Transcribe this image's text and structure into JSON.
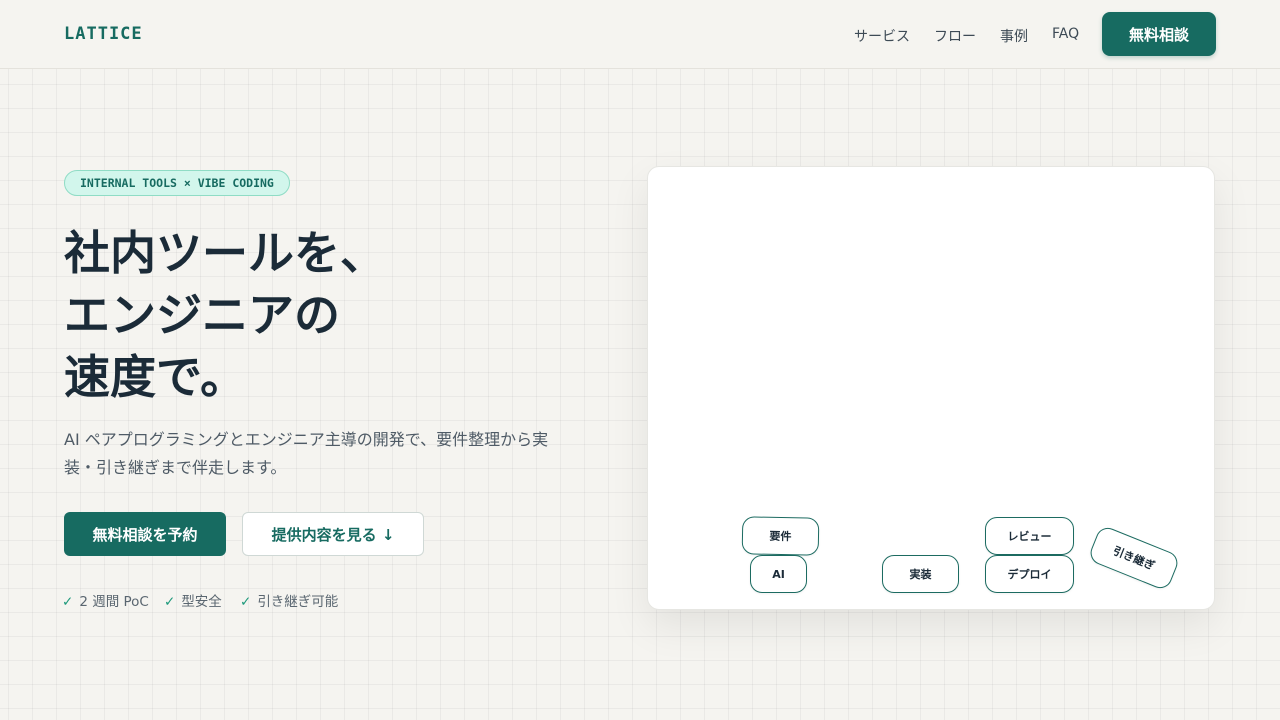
{
  "header": {
    "logo": "LATTICE",
    "nav": [
      "サービス",
      "フロー",
      "事例",
      "FAQ"
    ],
    "cta": "無料相談"
  },
  "hero": {
    "badge": "INTERNAL TOOLS × VIBE CODING",
    "headline": [
      "社内ツールを、",
      "エンジニアの",
      "速度で。"
    ],
    "lead": [
      "AI ペアプログラミングとエンジニア主導の開発で、要件整理から実",
      "装・引き継ぎまで伴走します。"
    ],
    "primary_button": "無料相談を予約",
    "secondary_button": "提供内容を見る ↓",
    "check_icon": "✓",
    "features": [
      "2 週間 PoC",
      "型安全",
      "引き継ぎ可能"
    ]
  },
  "canvas": {
    "chips": [
      "要件",
      "AI",
      "実装",
      "レビュー",
      "デプロイ",
      "引き継ぎ"
    ]
  },
  "colors": {
    "brand": "#176b61",
    "badge_bg": "#d2f6ec",
    "check": "#1f9a7c",
    "background": "#f5f4f0"
  }
}
